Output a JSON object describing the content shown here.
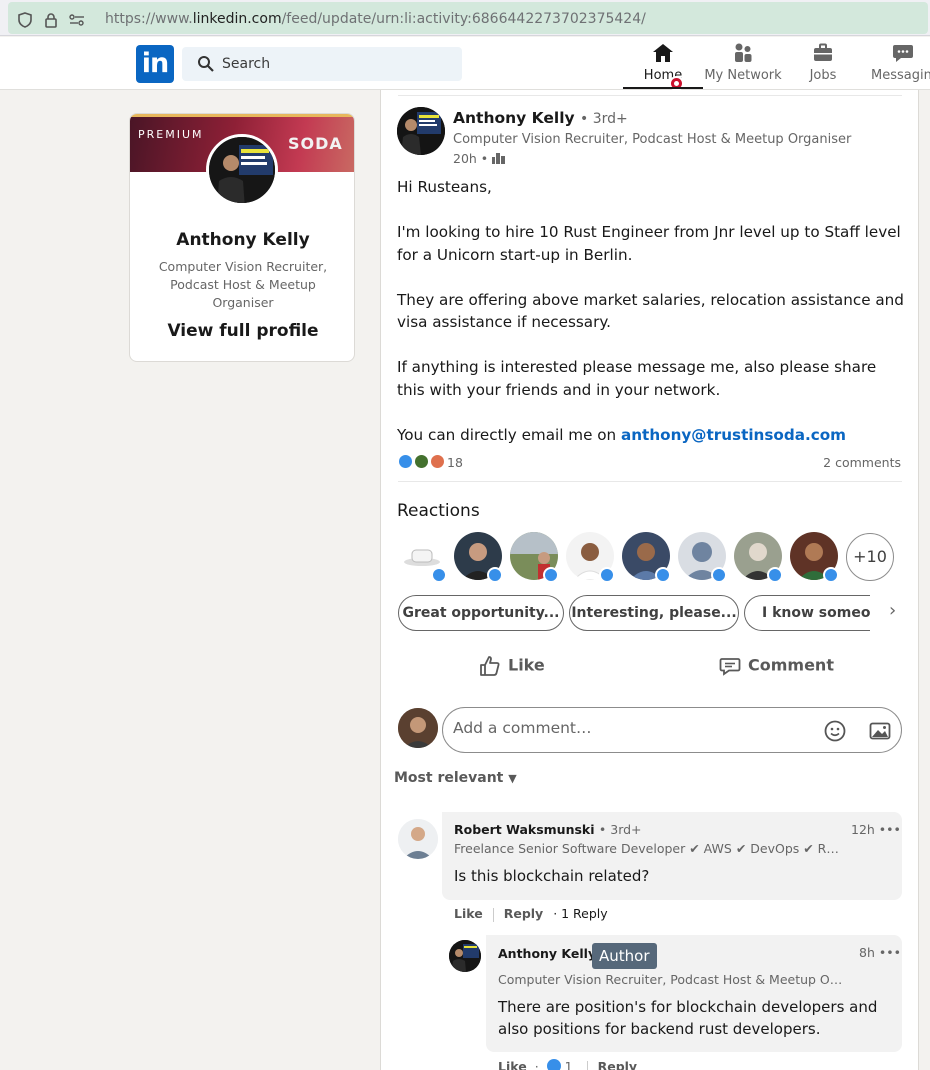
{
  "browser": {
    "url_prefix": "https://www.",
    "url_domain": "linkedin.com",
    "url_path": "/feed/update/urn:li:activity:6866442273702375424/"
  },
  "nav": {
    "logo": "in",
    "search_placeholder": "Search",
    "items": [
      {
        "label": "Home",
        "icon": "home-icon",
        "active": true
      },
      {
        "label": "My Network",
        "icon": "network-icon"
      },
      {
        "label": "Jobs",
        "icon": "briefcase-icon"
      },
      {
        "label": "Messaging",
        "icon": "messaging-icon"
      }
    ]
  },
  "profile_card": {
    "premium": "PREMIUM",
    "banner_brand": "SODA",
    "name": "Anthony Kelly",
    "headline": "Computer Vision Recruiter, Podcast Host & Meetup Organiser",
    "view_profile": "View full profile"
  },
  "post": {
    "author": {
      "name": "Anthony Kelly",
      "degree": "• 3rd+",
      "headline": "Computer Vision Recruiter, Podcast Host & Meetup Organiser",
      "time": "20h •"
    },
    "paragraphs": [
      "Hi Rusteans,",
      "I'm looking to hire 10 Rust Engineer from Jnr level up to Staff level for a Unicorn start-up in Berlin.",
      "They are offering above market salaries, relocation assistance and visa assistance if necessary.",
      "If anything is interested please message me, also please share this with your friends and in your network."
    ],
    "email_prefix": "You can directly email me on ",
    "email": "anthony@trustinsoda.com",
    "reaction_count": "18",
    "comments_count": "2 comments",
    "reactions_title": "Reactions",
    "more_reactors": "+10",
    "suggestions": [
      "Great opportunity...",
      "Interesting, please...",
      "I know someone"
    ],
    "actions": {
      "like": "Like",
      "comment": "Comment"
    },
    "comment_placeholder": "Add a comment…",
    "sort": "Most relevant"
  },
  "comments": [
    {
      "name": "Robert Waksmunski",
      "degree": "• 3rd+",
      "headline": "Freelance Senior Software Developer ✔ AWS ✔ DevOps ✔ R…",
      "time": "12h •••",
      "text": "Is this blockchain related?",
      "like": "Like",
      "reply": "Reply",
      "replies": "· 1 Reply"
    },
    {
      "name": "Anthony Kelly",
      "tag": "Author",
      "headline": "Computer Vision Recruiter, Podcast Host & Meetup O…",
      "time": "8h •••",
      "text": "There are position's for blockchain developers and also positions for backend rust developers.",
      "like": "Like",
      "like_count": "1",
      "reply": "Reply"
    }
  ],
  "colors": {
    "brand": "#0a66c2",
    "like_blue": "#378fe9",
    "notification": "#cb112d"
  }
}
